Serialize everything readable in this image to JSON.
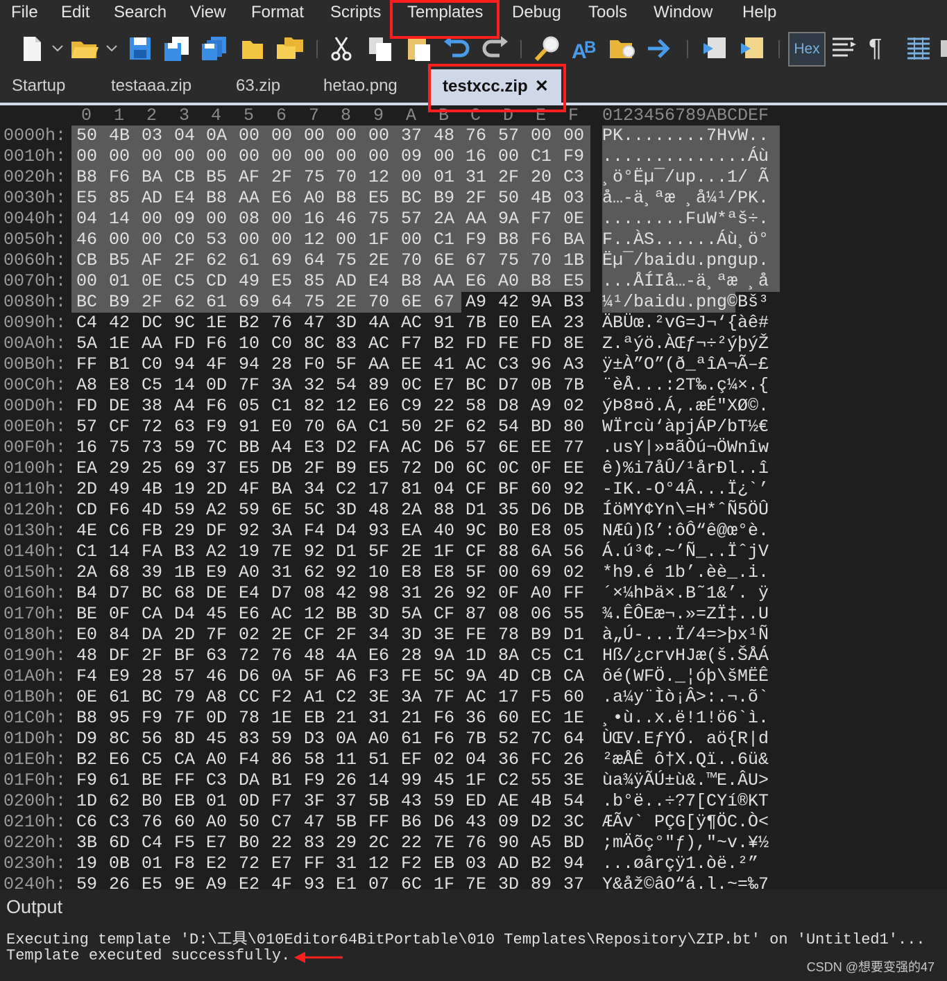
{
  "menu": [
    "File",
    "Edit",
    "Search",
    "View",
    "Format",
    "Scripts",
    "Templates",
    "Debug",
    "Tools",
    "Window",
    "Help"
  ],
  "toolbar": {
    "icons": [
      "new-file-icon",
      "new-file-dropdown-icon",
      "open-folder-icon",
      "open-dropdown-icon",
      "save-icon",
      "save-as-icon",
      "save-all-icon",
      "folder-icon",
      "folders-icon",
      "cut-icon",
      "copy-icon",
      "paste-icon",
      "undo-icon",
      "redo-icon",
      "find-icon",
      "replace-icon",
      "find-in-files-icon",
      "goto-icon",
      "run-script-icon",
      "run-template-icon",
      "hex-view-icon",
      "columns-icon",
      "pilcrow-icon",
      "grid-view-icon"
    ],
    "hex_label": "Hex",
    "pilcrow": "¶"
  },
  "tabs": [
    {
      "label": "Startup",
      "active": false
    },
    {
      "label": "testaaa.zip",
      "active": false
    },
    {
      "label": "63.zip",
      "active": false
    },
    {
      "label": "hetao.png",
      "active": false
    },
    {
      "label": "testxcc.zip",
      "active": true,
      "close": "✕"
    }
  ],
  "hex": {
    "columns": [
      "0",
      "1",
      "2",
      "3",
      "4",
      "5",
      "6",
      "7",
      "8",
      "9",
      "A",
      "B",
      "C",
      "D",
      "E",
      "F"
    ],
    "ascii_header": "0123456789ABCDEF",
    "rows": [
      {
        "addr": "0000h:",
        "bytes": "50 4B 03 04 0A 00 00 00 00 00 37 48 76 57 00 00",
        "ascii": "PK........7HvW.."
      },
      {
        "addr": "0010h:",
        "bytes": "00 00 00 00 00 00 00 00 00 00 09 00 16 00 C1 F9",
        "ascii": "..............Áù"
      },
      {
        "addr": "0020h:",
        "bytes": "B8 F6 BA CB B5 AF 2F 75 70 12 00 01 31 2F 20 C3",
        "ascii": "¸ö°Ëµ¯/up...1/ Ã"
      },
      {
        "addr": "0030h:",
        "bytes": "E5 85 AD E4 B8 AA E6 A0 B8 E5 BC B9 2F 50 4B 03",
        "ascii": "å…-ä¸ªæ ¸å¼¹/PK."
      },
      {
        "addr": "0040h:",
        "bytes": "04 14 00 09 00 08 00 16 46 75 57 2A AA 9A F7 0E",
        "ascii": "........FuW*ªš÷."
      },
      {
        "addr": "0050h:",
        "bytes": "46 00 00 C0 53 00 00 12 00 1F 00 C1 F9 B8 F6 BA",
        "ascii": "F..ÀS......Áù¸ö°"
      },
      {
        "addr": "0060h:",
        "bytes": "CB B5 AF 2F 62 61 69 64 75 2E 70 6E 67 75 70 1B",
        "ascii": "Ëµ¯/baidu.pngup."
      },
      {
        "addr": "0070h:",
        "bytes": "00 01 0E C5 CD 49 E5 85 AD E4 B8 AA E6 A0 B8 E5",
        "ascii": "...ÅÍIå…-ä¸ªæ ¸å"
      },
      {
        "addr": "0080h:",
        "bytes": "BC B9 2F 62 61 69 64 75 2E 70 6E 67 A9 42 9A B3",
        "ascii": "¼¹/baidu.png©Bš³"
      },
      {
        "addr": "0090h:",
        "bytes": "C4 42 DC 9C 1E B2 76 47 3D 4A AC 91 7B E0 EA 23",
        "ascii": "ÄBÜœ.²vG=J¬‘{àê#"
      },
      {
        "addr": "00A0h:",
        "bytes": "5A 1E AA FD F6 10 C0 8C 83 AC F7 B2 FD FE FD 8E",
        "ascii": "Z.ªýö.ÀŒƒ¬÷²ýþýŽ"
      },
      {
        "addr": "00B0h:",
        "bytes": "FF B1 C0 94 4F 94 28 F0 5F AA EE 41 AC C3 96 A3",
        "ascii": "ÿ±À”O”(ð_ªîA¬Ã–£"
      },
      {
        "addr": "00C0h:",
        "bytes": "A8 E8 C5 14 0D 7F 3A 32 54 89 0C E7 BC D7 0B 7B",
        "ascii": "¨èÅ...:2T‰.ç¼×.{"
      },
      {
        "addr": "00D0h:",
        "bytes": "FD DE 38 A4 F6 05 C1 82 12 E6 C9 22 58 D8 A9 02",
        "ascii": "ýÞ8¤ö.Á‚.æÉ\"XØ©."
      },
      {
        "addr": "00E0h:",
        "bytes": "57 CF 72 63 F9 91 E0 70 6A C1 50 2F 62 54 BD 80",
        "ascii": "WÏrcù‘àpjÁP/bT½€"
      },
      {
        "addr": "00F0h:",
        "bytes": "16 75 73 59 7C BB A4 E3 D2 FA AC D6 57 6E EE 77",
        "ascii": ".usY|»¤ãÒú¬ÖWnîw"
      },
      {
        "addr": "0100h:",
        "bytes": "EA 29 25 69 37 E5 DB 2F B9 E5 72 D0 6C 0C 0F EE",
        "ascii": "ê)%i7åÛ/¹årÐl..î"
      },
      {
        "addr": "0110h:",
        "bytes": "2D 49 4B 19 2D 4F BA 34 C2 17 81 04 CF BF 60 92",
        "ascii": "-IK.-O°4Â...Ï¿`’"
      },
      {
        "addr": "0120h:",
        "bytes": "CD F6 4D 59 A2 59 6E 5C 3D 48 2A 88 D1 35 D6 DB",
        "ascii": "ÍöMY¢Yn\\=H*ˆÑ5ÖÛ"
      },
      {
        "addr": "0130h:",
        "bytes": "4E C6 FB 29 DF 92 3A F4 D4 93 EA 40 9C B0 E8 05",
        "ascii": "NÆû)ß’:ôÔ“ê@œ°è."
      },
      {
        "addr": "0140h:",
        "bytes": "C1 14 FA B3 A2 19 7E 92 D1 5F 2E 1F CF 88 6A 56",
        "ascii": "Á.ú³¢.~’Ñ_..ÏˆjV"
      },
      {
        "addr": "0150h:",
        "bytes": "2A 68 39 1B E9 A0 31 62 92 10 E8 E8 5F 00 69 02",
        "ascii": "*h9.é 1b’.èè_.i."
      },
      {
        "addr": "0160h:",
        "bytes": "B4 D7 BC 68 DE E4 D7 08 42 98 31 26 92 0F A0 FF",
        "ascii": "´×¼hÞä×.B˜1&’. ÿ"
      },
      {
        "addr": "0170h:",
        "bytes": "BE 0F CA D4 45 E6 AC 12 BB 3D 5A CF 87 08 06 55",
        "ascii": "¾.ÊÔEæ¬.»=ZÏ‡..U"
      },
      {
        "addr": "0180h:",
        "bytes": "E0 84 DA 2D 7F 02 2E CF 2F 34 3D 3E FE 78 B9 D1",
        "ascii": "à„Ú-...Ï/4=>þx¹Ñ"
      },
      {
        "addr": "0190h:",
        "bytes": "48 DF 2F BF 63 72 76 48 4A E6 28 9A 1D 8A C5 C1",
        "ascii": "Hß/¿crvHJæ(š.ŠÅÁ"
      },
      {
        "addr": "01A0h:",
        "bytes": "F4 E9 28 57 46 D6 0A 5F A6 F3 FE 5C 9A 4D CB CA",
        "ascii": "ôé(WFÖ._¦óþ\\šMËÊ"
      },
      {
        "addr": "01B0h:",
        "bytes": "0E 61 BC 79 A8 CC F2 A1 C2 3E 3A 7F AC 17 F5 60",
        "ascii": ".a¼y¨Ìò¡Â>:.¬.õ`"
      },
      {
        "addr": "01C0h:",
        "bytes": "B8 95 F9 7F 0D 78 1E EB 21 31 21 F6 36 60 EC 1E",
        "ascii": "¸•ù..x.ë!1!ö6`ì."
      },
      {
        "addr": "01D0h:",
        "bytes": "D9 8C 56 8D 45 83 59 D3 0A A0 61 F6 7B 52 7C 64",
        "ascii": "ÙŒV.EƒYÓ. aö{R|d"
      },
      {
        "addr": "01E0h:",
        "bytes": "B2 E6 C5 CA A0 F4 86 58 11 51 EF 02 04 36 FC 26",
        "ascii": "²æÅÊ ô†X.Qï..6ü&"
      },
      {
        "addr": "01F0h:",
        "bytes": "F9 61 BE FF C3 DA B1 F9 26 14 99 45 1F C2 55 3E",
        "ascii": "ùa¾ÿÃÚ±ù&.™E.ÂU>"
      },
      {
        "addr": "0200h:",
        "bytes": "1D 62 B0 EB 01 0D F7 3F 37 5B 43 59 ED AE 4B 54",
        "ascii": ".b°ë..÷?7[CYí®KT"
      },
      {
        "addr": "0210h:",
        "bytes": "C6 C3 76 60 A0 50 C7 47 5B FF B6 D6 43 09 D2 3C",
        "ascii": "ÆÃv` PÇG[ÿ¶ÖC.Ò<"
      },
      {
        "addr": "0220h:",
        "bytes": "3B 6D C4 F5 E7 B0 22 83 29 2C 22 7E 76 90 A5 BD",
        "ascii": ";mÄõç°\"ƒ),\"~v.¥½"
      },
      {
        "addr": "0230h:",
        "bytes": "19 0B 01 F8 E2 72 E7 FF 31 12 F2 EB 03 AD B2 94",
        "ascii": "...øârçÿ1.òë.­²”"
      },
      {
        "addr": "0240h:",
        "bytes": "59 26 E5 9E A9 E2 4F 93 E1 07 6C 1F 7E 3D 89 37",
        "ascii": "Y&åž©âO“á.l.~=‰7"
      }
    ]
  },
  "output": {
    "title": "Output",
    "lines": [
      "Executing template 'D:\\工具\\010Editor64BitPortable\\010 Templates\\Repository\\ZIP.bt' on 'Untitled1'...",
      "Template executed successfully."
    ]
  },
  "watermark": "CSDN @想要变强的47"
}
